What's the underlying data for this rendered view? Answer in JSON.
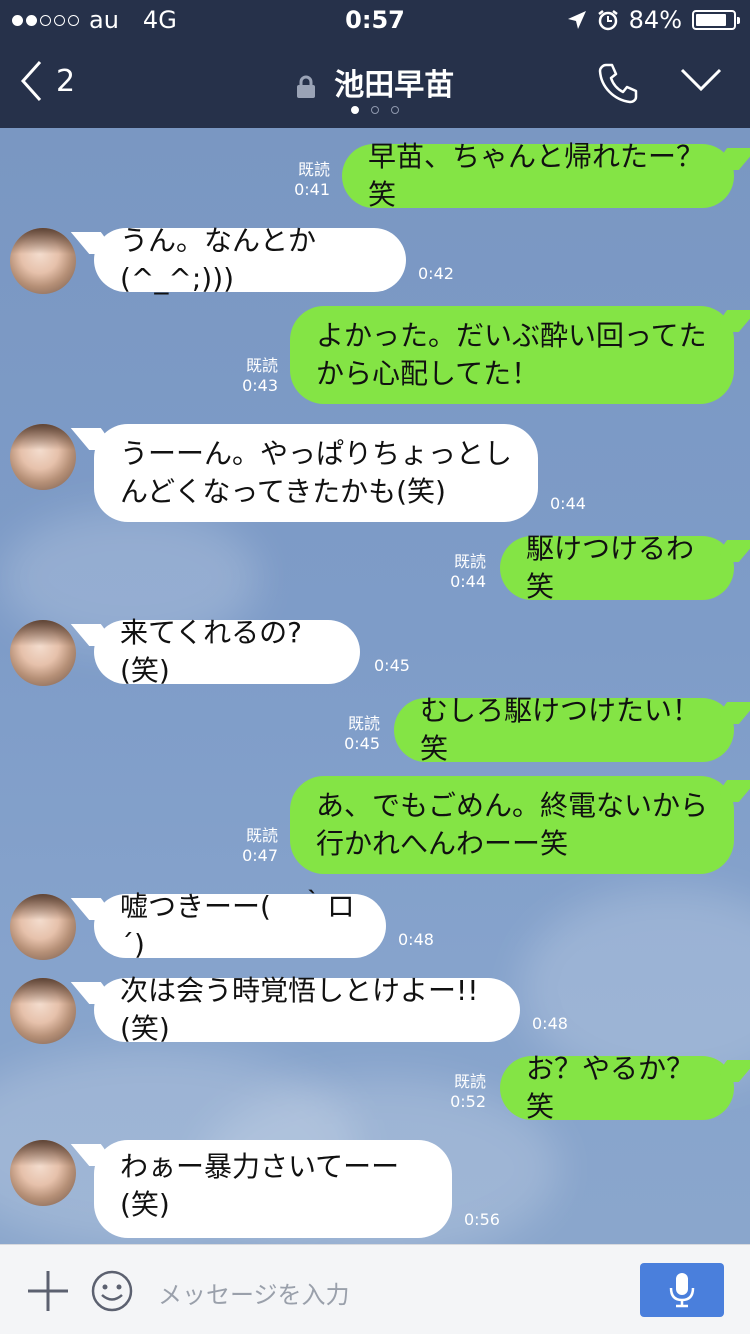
{
  "status": {
    "carrier": "au",
    "network": "4G",
    "time": "0:57",
    "battery": "84%",
    "battery_level": 0.84,
    "signal_bars": 2,
    "icons": [
      "location-arrow-icon",
      "alarm-icon",
      "battery-icon"
    ]
  },
  "header": {
    "back_count": "2",
    "title": "池田早苗",
    "page_count": 3,
    "page_active": 0,
    "icons": [
      "back-chevron-icon",
      "lock-icon",
      "phone-icon",
      "chevron-down-icon"
    ]
  },
  "messages": [
    {
      "side": "out",
      "text": "早苗、ちゃんと帰れたー？笑",
      "read": "既読",
      "time": "0:41"
    },
    {
      "side": "in",
      "text": "うん。なんとか(^_^;)))",
      "time": "0:42"
    },
    {
      "side": "out",
      "text": "よかった。だいぶ酔い回ってたから心配してた！",
      "read": "既読",
      "time": "0:43"
    },
    {
      "side": "in",
      "text": "うーーん。やっぱりちょっとしんどくなってきたかも(笑)",
      "time": "0:44"
    },
    {
      "side": "out",
      "text": "駆けつけるわ笑",
      "read": "既読",
      "time": "0:44"
    },
    {
      "side": "in",
      "text": "来てくれるの?(笑)",
      "time": "0:45"
    },
    {
      "side": "out",
      "text": "むしろ駆けつけたい！笑",
      "read": "既読",
      "time": "0:45"
    },
    {
      "side": "out",
      "text": "あ、でもごめん。終電ないから行かれへんわーー笑",
      "read": "既読",
      "time": "0:47"
    },
    {
      "side": "in",
      "text": "嘘つきーー(　｀ロ´)",
      "time": "0:48"
    },
    {
      "side": "in",
      "text": "次は会う時覚悟しとけよー!!(笑)",
      "time": "0:48"
    },
    {
      "side": "out",
      "text": "お？やるか？笑",
      "read": "既読",
      "time": "0:52"
    },
    {
      "side": "in",
      "text": "わぁー暴力さいてーー(笑)",
      "time": "0:56"
    }
  ],
  "input": {
    "placeholder": "メッセージを入力",
    "icons": [
      "plus-icon",
      "emoji-icon",
      "microphone-icon"
    ]
  }
}
